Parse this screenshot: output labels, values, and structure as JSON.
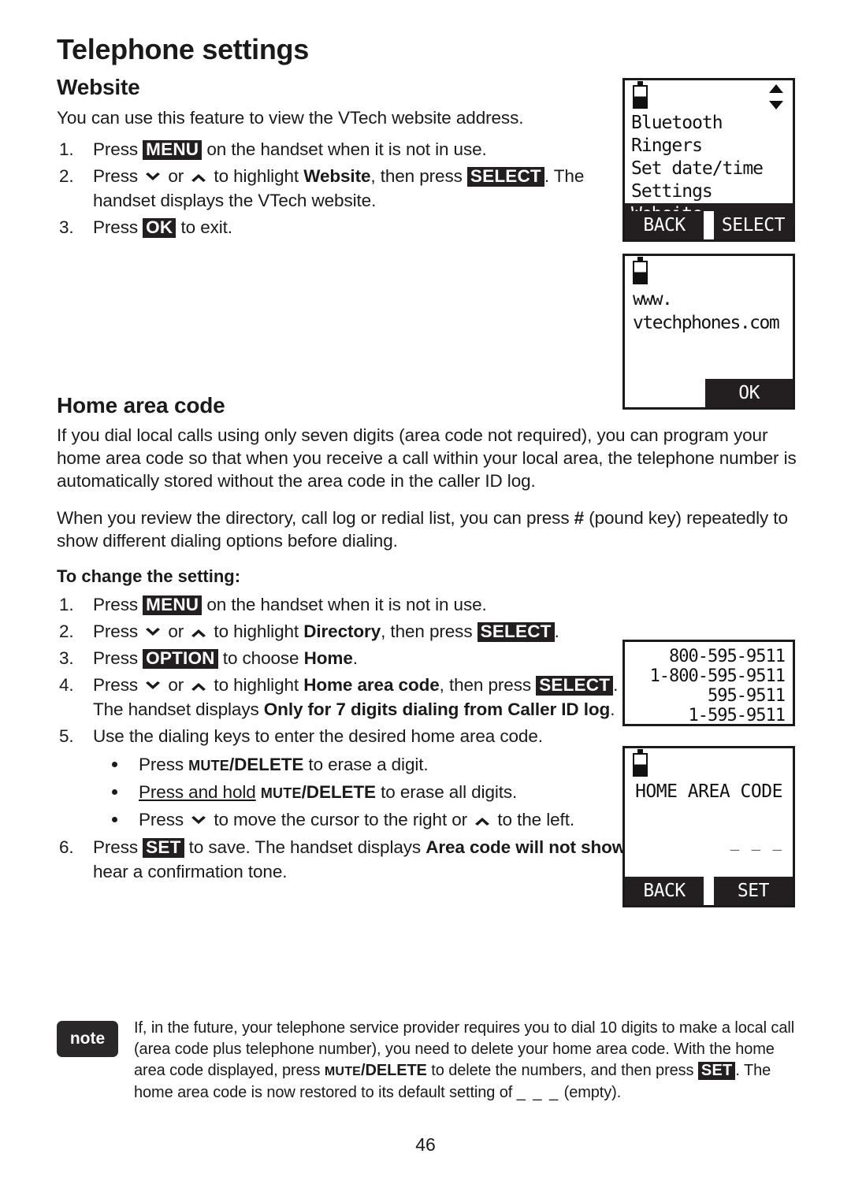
{
  "page": {
    "chapter_title": "Telephone settings",
    "page_number": "46"
  },
  "website_section": {
    "title": "Website",
    "intro": "You can use this feature to view the VTech website address.",
    "steps": [
      {
        "num": "1.",
        "pre": "Press ",
        "key1": "MENU",
        "post": " on the handset when it is not in use."
      },
      {
        "num": "2.",
        "pre": "Press ",
        "mid_or": " or ",
        "to_highlight": " to highlight ",
        "bold_target": "Website",
        "then_press": ", then press ",
        "key1": "SELECT",
        "post": ". The handset displays the VTech website."
      },
      {
        "num": "3.",
        "pre": "Press ",
        "key1": "OK",
        "post": " to exit."
      }
    ]
  },
  "home_area_code_section": {
    "title": "Home area code",
    "para1": "If you dial local calls using only seven digits (area code not required), you can program your home area code so that when you receive a call within your local area, the telephone number is automatically stored without the area code in the caller ID log.",
    "para2_a": "When you review the directory, call log or redial list, you can press ",
    "para2_hash": "#",
    "para2_b": " (pound key) repeatedly to show different dialing options before dialing.",
    "subtitle": "To change the setting:",
    "steps": [
      {
        "num": "1.",
        "pre": "Press ",
        "key1": "MENU",
        "post": " on the handset when it is not in use."
      },
      {
        "num": "2.",
        "pre": "Press ",
        "mid_or": " or ",
        "to_highlight": " to highlight ",
        "bold_target": "Directory",
        "then": ", then press ",
        "key1": "SELECT",
        "post": "."
      },
      {
        "num": "3.",
        "pre": "Press ",
        "key1": "OPTION",
        "mid": " to choose ",
        "bold_target": "Home",
        "post": "."
      },
      {
        "num": "4.",
        "pre": "Press ",
        "mid_or": " or ",
        "to_highlight": " to highlight ",
        "bold_target": "Home area code",
        "then": ", then press ",
        "key1": "SELECT",
        "mid2": ". The handset displays ",
        "bold_msg": "Only for 7 digits dialing from Caller ID log",
        "post": "."
      },
      {
        "num": "5.",
        "text": "Use the dialing keys to enter the desired home area code."
      },
      {
        "num": "6.",
        "pre": "Press ",
        "key1": "SET",
        "mid": " to save. The handset displays ",
        "bold_msg": "Area code will not show in Caller ID log",
        "post": ". You hear a confirmation tone."
      }
    ],
    "bullets": [
      {
        "pre": "Press ",
        "smallcaps": "MUTE",
        "bold": "/DELETE",
        "post": " to erase a digit."
      },
      {
        "underlined": "Press and hold",
        "space": " ",
        "smallcaps": "MUTE",
        "bold": "/DELETE",
        "post": " to erase all digits."
      },
      {
        "pre": "Press ",
        "mid": " to move the cursor to the right or ",
        "post": " to the left."
      }
    ]
  },
  "note": {
    "badge_label": "note",
    "line1": "If, in the future, your telephone service provider requires you to dial 10 digits",
    "line2": "to make a local call (area code plus telephone number), you need to delete",
    "line3": "your home area code. With the home area code displayed, press",
    "line4_smallcaps": "MUTE",
    "line4_bold": "/DELETE",
    "line4_mid": " to delete the numbers, and then press ",
    "line4_key": "SET",
    "line4_post": ". The home area",
    "line5_pre": "code is now restored to its default setting of ",
    "line5_blank": "_ _ _",
    "line5_post": " (empty)."
  },
  "lcd_menu_screen": {
    "name": "handset-menu-screen",
    "battery_icon": "battery-half-icon",
    "scroll_icon": "scroll-up-down-icon",
    "items": [
      {
        "label": "Bluetooth",
        "selected": false
      },
      {
        "label": "Ringers",
        "selected": false
      },
      {
        "label": "Set date/time",
        "selected": false
      },
      {
        "label": "Settings",
        "selected": false
      },
      {
        "label": "Website",
        "selected": true
      }
    ],
    "softkey_left": "BACK",
    "softkey_right": "SELECT"
  },
  "lcd_website_screen": {
    "name": "handset-website-screen",
    "battery_icon": "battery-half-icon",
    "line1": "www.",
    "line2": "vtechphones.com",
    "softkey_right": "OK"
  },
  "lcd_dial_options": {
    "name": "handset-dialing-options-screen",
    "numbers": [
      "800-595-9511",
      "1-800-595-9511",
      "595-9511",
      "1-595-9511"
    ]
  },
  "lcd_home_area_code": {
    "name": "handset-home-area-code-screen",
    "battery_icon": "battery-half-icon",
    "title": "HOME AREA CODE",
    "entry_blank": "_ _ _",
    "softkey_left": "BACK",
    "softkey_right": "SET"
  },
  "colors": {
    "ink": "#1a1a1a",
    "key_badge": "#231f20",
    "note_badge": "#2b2829",
    "paper": "#ffffff"
  }
}
